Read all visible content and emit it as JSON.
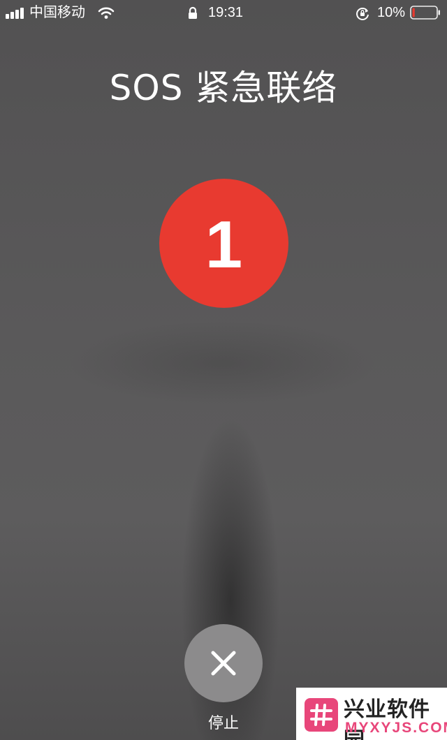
{
  "status_bar": {
    "carrier": "中国移动",
    "time": "19:31",
    "battery_percent": "10%",
    "battery_level": 0.1,
    "icons": [
      "signal-icon",
      "wifi-icon",
      "lock-icon",
      "rotation-lock-icon",
      "battery-icon"
    ]
  },
  "screen": {
    "title": "SOS 紧急联络",
    "countdown": "1"
  },
  "actions": {
    "stop_label": "停止",
    "stop_icon": "close-icon"
  },
  "watermark": {
    "name": "兴业软件园",
    "url": "MYXYJS.COM"
  },
  "colors": {
    "countdown_red": "#e83a30",
    "stop_button": "#8c8b8c",
    "background": "#555455",
    "watermark_accent": "#e8467a"
  }
}
